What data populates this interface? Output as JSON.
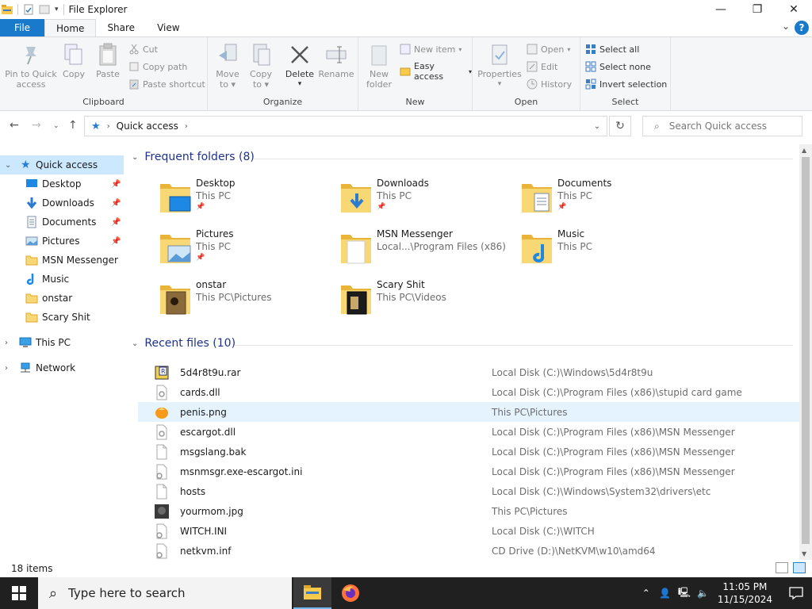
{
  "window": {
    "title": "File Explorer"
  },
  "ribbon_tabs": {
    "file": "File",
    "home": "Home",
    "share": "Share",
    "view": "View"
  },
  "ribbon": {
    "clipboard": {
      "label": "Clipboard",
      "pin_line1": "Pin to Quick",
      "pin_line2": "access",
      "copy": "Copy",
      "paste": "Paste",
      "cut": "Cut",
      "copy_path": "Copy path",
      "paste_shortcut": "Paste shortcut"
    },
    "organize": {
      "label": "Organize",
      "move_line1": "Move",
      "move_line2": "to",
      "copy_line1": "Copy",
      "copy_line2": "to",
      "delete": "Delete",
      "rename": "Rename"
    },
    "new": {
      "label": "New",
      "new_folder_line1": "New",
      "new_folder_line2": "folder",
      "new_item": "New item",
      "easy_access": "Easy access"
    },
    "open": {
      "label": "Open",
      "properties": "Properties",
      "open": "Open",
      "edit": "Edit",
      "history": "History"
    },
    "select": {
      "label": "Select",
      "select_all": "Select all",
      "select_none": "Select none",
      "invert": "Invert selection"
    }
  },
  "address": {
    "crumb": "Quick access",
    "search_placeholder": "Search Quick access"
  },
  "nav_pane": {
    "quick_access": "Quick access",
    "items": [
      {
        "label": "Desktop",
        "icon": "desktop-icon",
        "pinned": true
      },
      {
        "label": "Downloads",
        "icon": "downloads-icon",
        "pinned": true
      },
      {
        "label": "Documents",
        "icon": "documents-icon",
        "pinned": true
      },
      {
        "label": "Pictures",
        "icon": "pictures-icon",
        "pinned": true
      },
      {
        "label": "MSN Messenger",
        "icon": "folder-icon",
        "pinned": false
      },
      {
        "label": "Music",
        "icon": "music-icon",
        "pinned": false
      },
      {
        "label": "onstar",
        "icon": "folder-icon",
        "pinned": false
      },
      {
        "label": "Scary Shit",
        "icon": "folder-icon",
        "pinned": false
      }
    ],
    "this_pc": "This PC",
    "network": "Network"
  },
  "frequent": {
    "header": "Frequent folders (8)",
    "folders": [
      {
        "name": "Desktop",
        "location": "This PC",
        "pinned": true
      },
      {
        "name": "Downloads",
        "location": "This PC",
        "pinned": true
      },
      {
        "name": "Documents",
        "location": "This PC",
        "pinned": true
      },
      {
        "name": "Pictures",
        "location": "This PC",
        "pinned": true
      },
      {
        "name": "MSN Messenger",
        "location": "Local...\\Program Files (x86)",
        "pinned": false
      },
      {
        "name": "Music",
        "location": "This PC",
        "pinned": false
      },
      {
        "name": "onstar",
        "location": "This PC\\Pictures",
        "pinned": false
      },
      {
        "name": "Scary Shit",
        "location": "This PC\\Videos",
        "pinned": false
      }
    ]
  },
  "recent": {
    "header": "Recent files (10)",
    "files": [
      {
        "name": "5d4r8t9u.rar",
        "path": "Local Disk (C:)\\Windows\\5d4r8t9u",
        "icon": "rar-icon"
      },
      {
        "name": "cards.dll",
        "path": "Local Disk (C:)\\Program Files (x86)\\stupid card game",
        "icon": "dll-icon"
      },
      {
        "name": "penis.png",
        "path": "This PC\\Pictures",
        "icon": "image-icon"
      },
      {
        "name": "escargot.dll",
        "path": "Local Disk (C:)\\Program Files (x86)\\MSN Messenger",
        "icon": "dll-icon"
      },
      {
        "name": "msgslang.bak",
        "path": "Local Disk (C:)\\Program Files (x86)\\MSN Messenger",
        "icon": "file-icon"
      },
      {
        "name": "msnmsgr.exe-escargot.ini",
        "path": "Local Disk (C:)\\Program Files (x86)\\MSN Messenger",
        "icon": "ini-icon"
      },
      {
        "name": "hosts",
        "path": "Local Disk (C:)\\Windows\\System32\\drivers\\etc",
        "icon": "file-icon"
      },
      {
        "name": "yourmom.jpg",
        "path": "This PC\\Pictures",
        "icon": "photo-icon"
      },
      {
        "name": "WITCH.INI",
        "path": "Local Disk (C:)\\WITCH",
        "icon": "ini-icon"
      },
      {
        "name": "netkvm.inf",
        "path": "CD Drive (D:)\\NetKVM\\w10\\amd64",
        "icon": "ini-icon"
      }
    ]
  },
  "status": {
    "count": "18 items"
  },
  "taskbar": {
    "search_placeholder": "Type here to search",
    "time": "11:05 PM",
    "date": "11/15/2024"
  }
}
